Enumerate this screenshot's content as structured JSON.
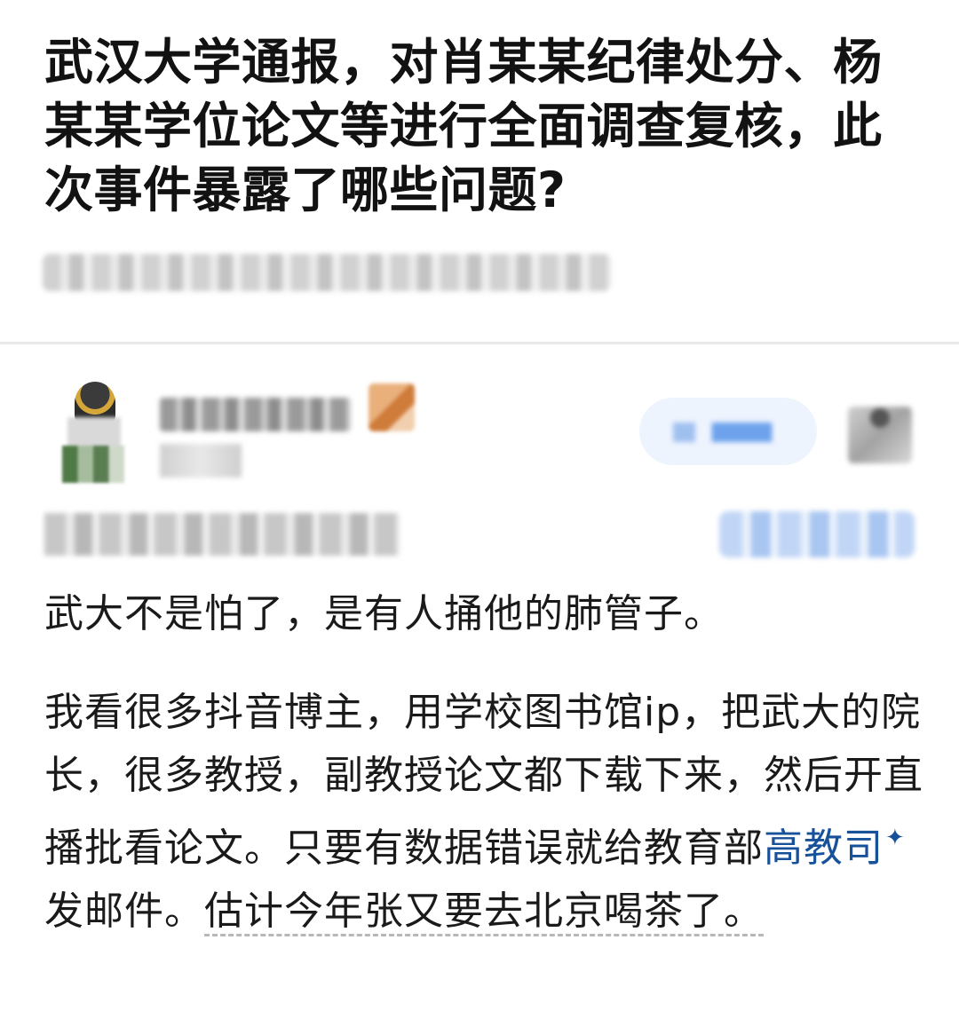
{
  "question": {
    "title": "武汉大学通报，对肖某某纪律处分、杨某某学位论文等进行全面调查复核，此次事件暴露了哪些问题?"
  },
  "answer": {
    "paragraph1": "武大不是怕了，是有人捅他的肺管子。",
    "paragraph2_part1": "我看很多抖音博主，用学校图书馆ip，把武大的院长，很多教授，副教授论文都下载下来，然后开直播批看论文。只要有数据错误就给教育部",
    "paragraph2_link": "高教司",
    "paragraph2_spark": "✦",
    "paragraph2_part2": "发邮件。",
    "paragraph2_part3": "估计今年张又要去北京喝茶了。"
  }
}
